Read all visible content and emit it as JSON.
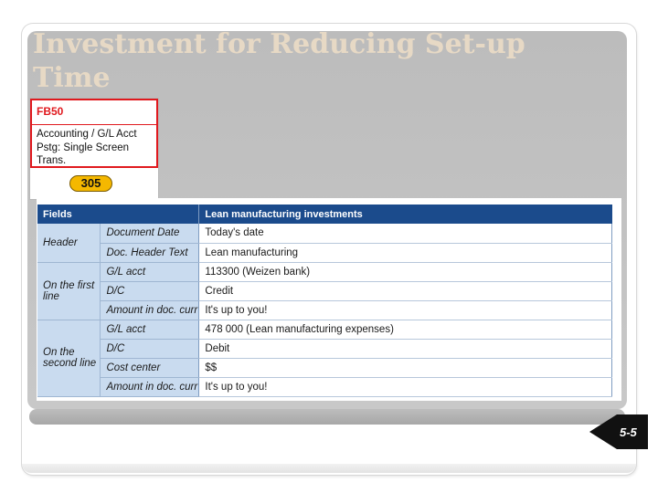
{
  "slide": {
    "title": "Investment for Reducing Set-up Time",
    "page_number": "5-5"
  },
  "card": {
    "tcode": "FB50",
    "menu_lines": [
      "Accounting / G/L Acct",
      "Pstg: Single Screen",
      "Trans."
    ],
    "badge": "305"
  },
  "table": {
    "headers": [
      "Fields",
      "Lean manufacturing investments"
    ],
    "groups": [
      {
        "label": "Header",
        "rows": [
          {
            "field": "Document Date",
            "value": "Today's date"
          },
          {
            "field": "Doc. Header Text",
            "value": "Lean manufacturing"
          }
        ]
      },
      {
        "label": "On the first line",
        "rows": [
          {
            "field": "G/L acct",
            "value": "113300 (Weizen bank)"
          },
          {
            "field": "D/C",
            "value": "Credit"
          },
          {
            "field": "Amount in doc. curr",
            "value": "It's up to you!"
          }
        ]
      },
      {
        "label": "On the second line",
        "rows": [
          {
            "field": "G/L acct",
            "value": "478 000 (Lean manufacturing expenses)"
          },
          {
            "field": "D/C",
            "value": "Debit"
          },
          {
            "field": "Cost center",
            "value": "$$"
          },
          {
            "field": "Amount in doc. curr",
            "value": "It's up to you!"
          }
        ]
      }
    ]
  },
  "colors": {
    "title": "#e7d9c5",
    "panel": "#c2c2c2",
    "table_header": "#1b4b8c",
    "table_label_cell": "#c9dbef",
    "tcode_red": "#e0191e",
    "badge_yellow": "#f5b800"
  }
}
